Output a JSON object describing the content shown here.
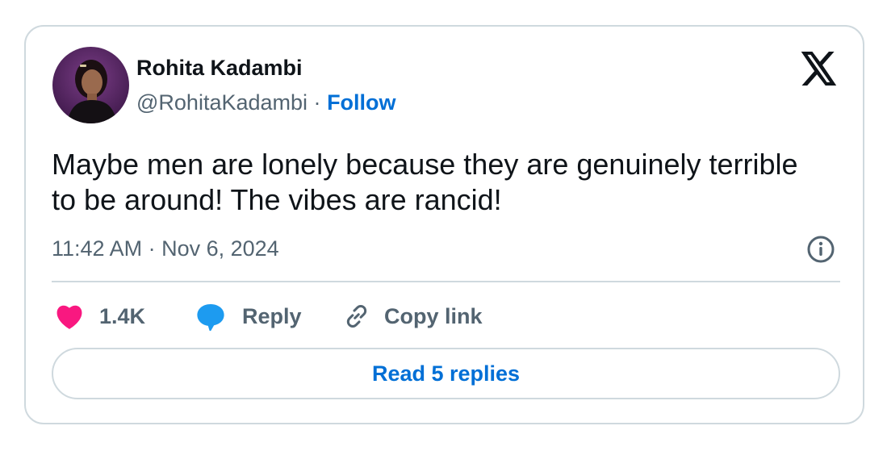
{
  "author": {
    "name": "Rohita Kadambi",
    "handle": "@RohitaKadambi",
    "separator": "·",
    "follow_label": "Follow"
  },
  "tweet": {
    "text": "Maybe men are lonely because they are genuinely terrible to be around! The vibes are rancid!",
    "timestamp": "11:42 AM · Nov 6, 2024"
  },
  "actions": {
    "likes_count": "1.4K",
    "reply_label": "Reply",
    "copy_link_label": "Copy link"
  },
  "read_replies_label": "Read 5 replies",
  "colors": {
    "link_blue": "#006fd6",
    "heart_pink": "#f91880",
    "reply_blue": "#1d9bf0",
    "secondary_text": "#536471",
    "primary_text": "#0f1419",
    "border": "#cfd9de"
  },
  "icons": {
    "brand": "x-logo-icon",
    "info": "info-icon",
    "like": "heart-icon",
    "reply": "speech-bubble-icon",
    "copy": "link-icon"
  }
}
